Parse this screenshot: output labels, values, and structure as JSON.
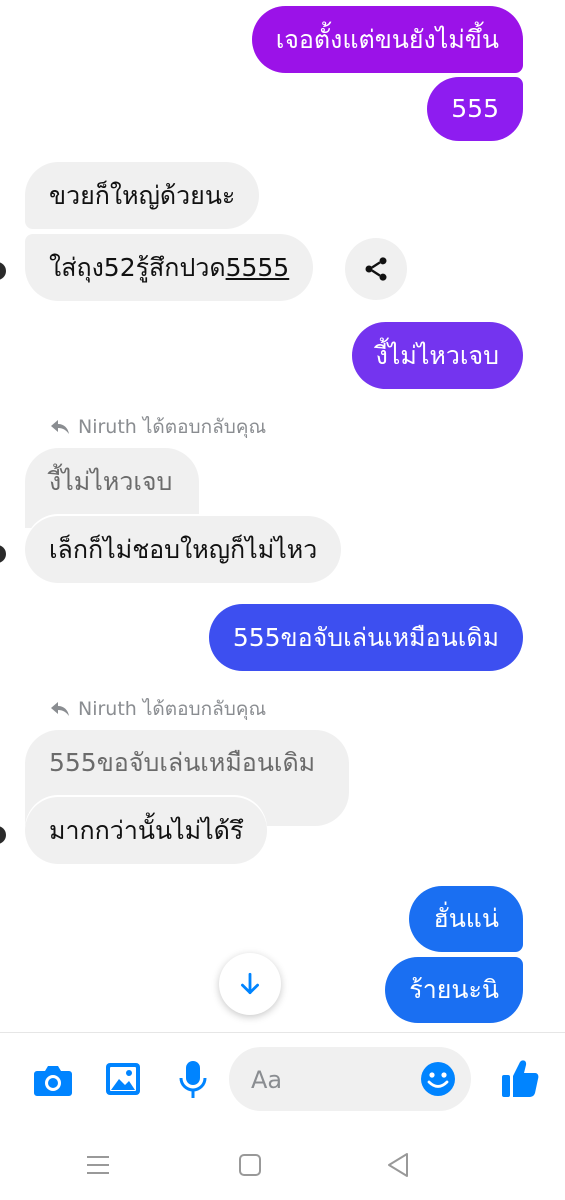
{
  "colors": {
    "outgoing_1": "#9b12e8",
    "outgoing_2": "#8e1cf0",
    "outgoing_3": "#7434ef",
    "outgoing_4": "#3d4ff0",
    "outgoing_5": "#1a6ff2",
    "incoming_bg": "#f0f0f0",
    "accent": "#0084ff"
  },
  "messages": {
    "m1": "เจอตั้งแต่ขนยังไม่ขึ้น",
    "m2": "555",
    "m3": "ขวยก็ใหญ่ด้วยนะ",
    "m4_text": "ใส่ถุง52รู้สึกปวด",
    "m4_link": "5555",
    "m5": "งี้ไม่ไหวเจบ",
    "reply1_label": "Niruth ได้ตอบกลับคุณ",
    "reply1_quote": "งี้ไม่ไหวเจบ",
    "m6": "เล็กก็ไม่ชอบใหญก็ไม่ไหว",
    "m7": "555ขอจับเล่นเหมือนเดิม",
    "reply2_label": "Niruth ได้ตอบกลับคุณ",
    "reply2_quote": "555ขอจับเล่นเหมือนเดิม",
    "m8": "มากกว่านั้นไม่ได้รึ",
    "m9": "ฮั่นแน่",
    "m10": "ร้ายนะนิ"
  },
  "composer": {
    "placeholder": "Aa"
  },
  "icons": {
    "camera": "camera-icon",
    "gallery": "image-icon",
    "mic": "microphone-icon",
    "emoji": "emoji-icon",
    "like": "thumbs-up-icon",
    "share": "share-icon",
    "scroll_down": "arrow-down-icon",
    "reply": "reply-icon",
    "nav_menu": "recent-apps-icon",
    "nav_home": "home-icon",
    "nav_back": "back-icon"
  }
}
